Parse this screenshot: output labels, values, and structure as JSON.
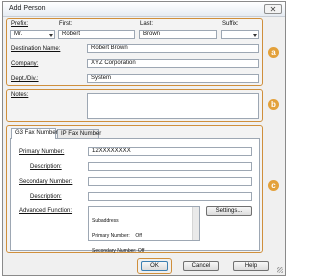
{
  "window": {
    "title": "Add Person",
    "close_glyph": "✕"
  },
  "section_a": {
    "badge": "a",
    "prefix_label": "Prefix:",
    "prefix_value": "Mr.",
    "first_label": "First:",
    "first_value": "Robert",
    "last_label": "Last:",
    "last_value": "Brown",
    "suffix_label": "Suffix:",
    "suffix_value": "",
    "destination_label": "Destination Name:",
    "destination_value": "Robert Brown",
    "company_label": "Company:",
    "company_value": "XYZ Corporation",
    "dept_label": "Dept./Div.:",
    "dept_value": "System"
  },
  "section_b": {
    "badge": "b",
    "notes_label": "Notes:",
    "notes_value": ""
  },
  "section_c": {
    "badge": "c",
    "tabs": [
      {
        "label": "G3 Fax Number",
        "active": true
      },
      {
        "label": "IP Fax Number",
        "active": false
      }
    ],
    "primary_label": "Primary Number:",
    "primary_value": "12XXXXXXXX",
    "desc1_label": "Description:",
    "desc1_value": "",
    "secondary_label": "Secondary Number:",
    "secondary_value": "",
    "desc2_label": "Description:",
    "desc2_value": "",
    "advanced_label": "Advanced Function:",
    "advanced_lines": [
      "Subaddress",
      "Primary Number:    Off",
      "Secondary Number: Off"
    ],
    "settings_button": "Settings..."
  },
  "footer": {
    "ok": "OK",
    "cancel": "Cancel",
    "help": "Help"
  },
  "colors": {
    "highlight": "#cf8f3c",
    "badge": "#e3a13b"
  }
}
